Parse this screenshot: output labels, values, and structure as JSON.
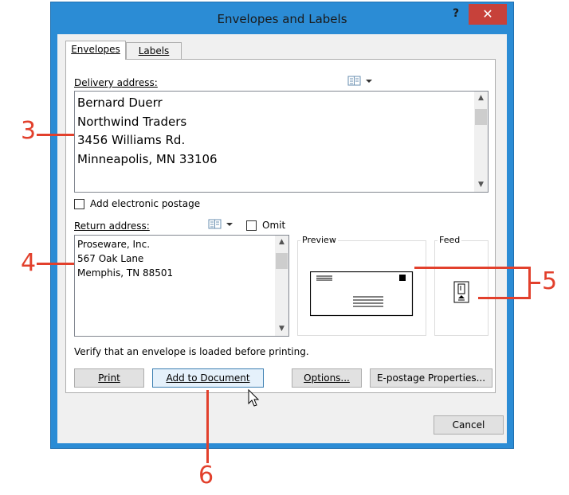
{
  "window": {
    "title": "Envelopes and Labels",
    "help": "?",
    "close": "✕"
  },
  "tabs": [
    {
      "label": "Envelopes"
    },
    {
      "label": "Labels"
    }
  ],
  "delivery": {
    "label": "Delivery address:",
    "lines": [
      "Bernard Duerr",
      "Northwind Traders",
      "3456 Williams Rd.",
      "Minneapolis, MN 33106"
    ]
  },
  "postage": {
    "label": "Add electronic postage"
  },
  "return": {
    "label": "Return address:",
    "omit_label": "Omit",
    "lines": [
      "Proseware, Inc.",
      "567 Oak Lane",
      "Memphis, TN 88501"
    ]
  },
  "preview": {
    "label": "Preview"
  },
  "feed": {
    "label": "Feed"
  },
  "verify_text": "Verify that an envelope is loaded before printing.",
  "buttons": {
    "print": "Print",
    "add": "Add to Document",
    "options": "Options...",
    "epostage": "E-postage Properties...",
    "cancel": "Cancel"
  },
  "callouts": [
    "3",
    "4",
    "5",
    "6"
  ],
  "colors": {
    "accent": "#2b8cd5",
    "close": "#c7413a",
    "callout": "#e2402c"
  }
}
